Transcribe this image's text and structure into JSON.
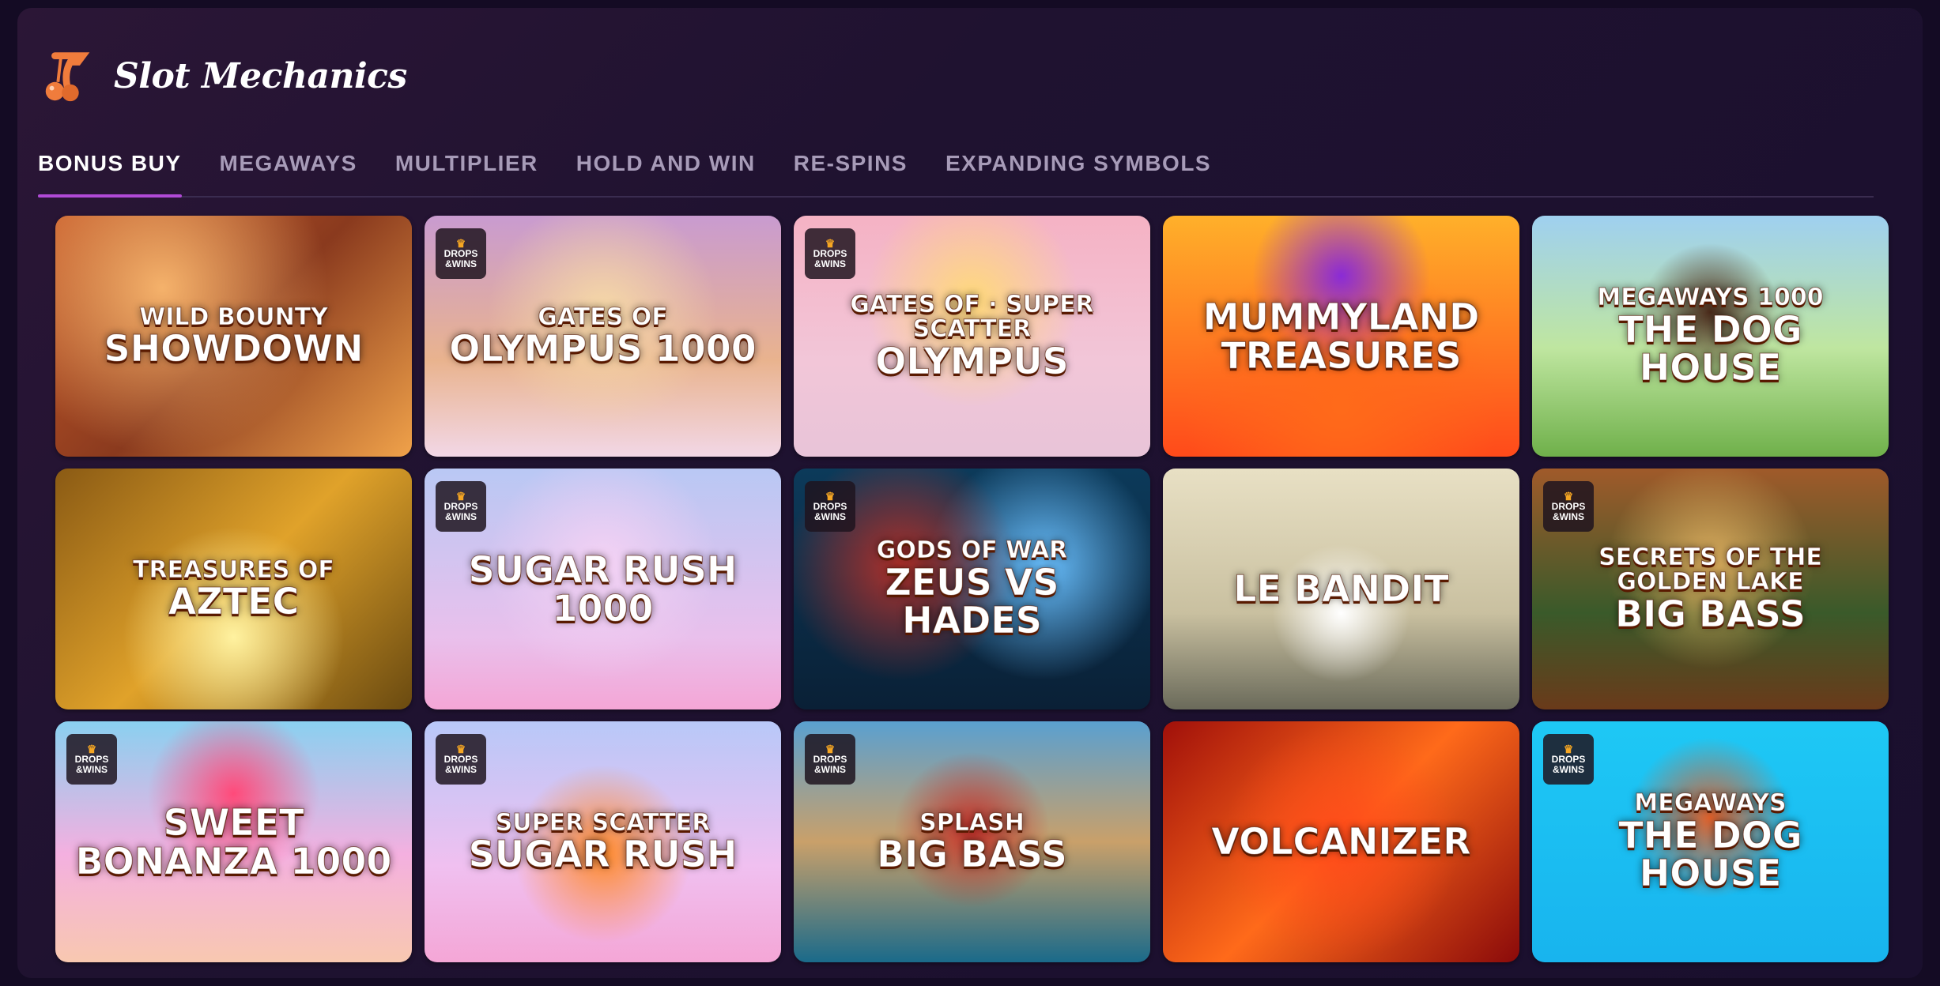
{
  "header": {
    "title": "Slot Mechanics",
    "logo_icon": "cherry-seven-icon"
  },
  "tabs": [
    {
      "label": "BONUS BUY",
      "active": true
    },
    {
      "label": "MEGAWAYS",
      "active": false
    },
    {
      "label": "MULTIPLIER",
      "active": false
    },
    {
      "label": "HOLD AND WIN",
      "active": false
    },
    {
      "label": "RE-SPINS",
      "active": false
    },
    {
      "label": "EXPANDING SYMBOLS",
      "active": false
    }
  ],
  "badge": {
    "line1": "DROPS",
    "line2": "&WINS"
  },
  "games": [
    {
      "title": "SHOWDOWN",
      "sub": "WILD BOUNTY",
      "badge": false
    },
    {
      "title": "OLYMPUS 1000",
      "sub": "Gates of",
      "badge": true
    },
    {
      "title": "OLYMPUS",
      "sub": "Gates of · SUPER SCATTER",
      "badge": true
    },
    {
      "title": "MUMMYLAND TREASURES",
      "sub": "",
      "badge": false
    },
    {
      "title": "THE DOG HOUSE",
      "sub": "MEGAWAYS 1000",
      "badge": false
    },
    {
      "title": "AZTEC",
      "sub": "TREASURES OF",
      "badge": false
    },
    {
      "title": "Sugar RUSH 1000",
      "sub": "",
      "badge": true
    },
    {
      "title": "ZEUS vs HADES",
      "sub": "GODS OF WAR",
      "badge": true
    },
    {
      "title": "LE BANDIT",
      "sub": "",
      "badge": false
    },
    {
      "title": "BIG BASS",
      "sub": "Secrets of The Golden Lake",
      "badge": true
    },
    {
      "title": "SWEET BONANZA 1000",
      "sub": "",
      "badge": true
    },
    {
      "title": "Sugar RUSH",
      "sub": "SUPER SCATTER",
      "badge": true
    },
    {
      "title": "BIG BASS",
      "sub": "SPLASH",
      "badge": true
    },
    {
      "title": "VOLCANIZER",
      "sub": "",
      "badge": false
    },
    {
      "title": "THE DOG HOUSE",
      "sub": "MEGAWAYS",
      "badge": true
    }
  ]
}
